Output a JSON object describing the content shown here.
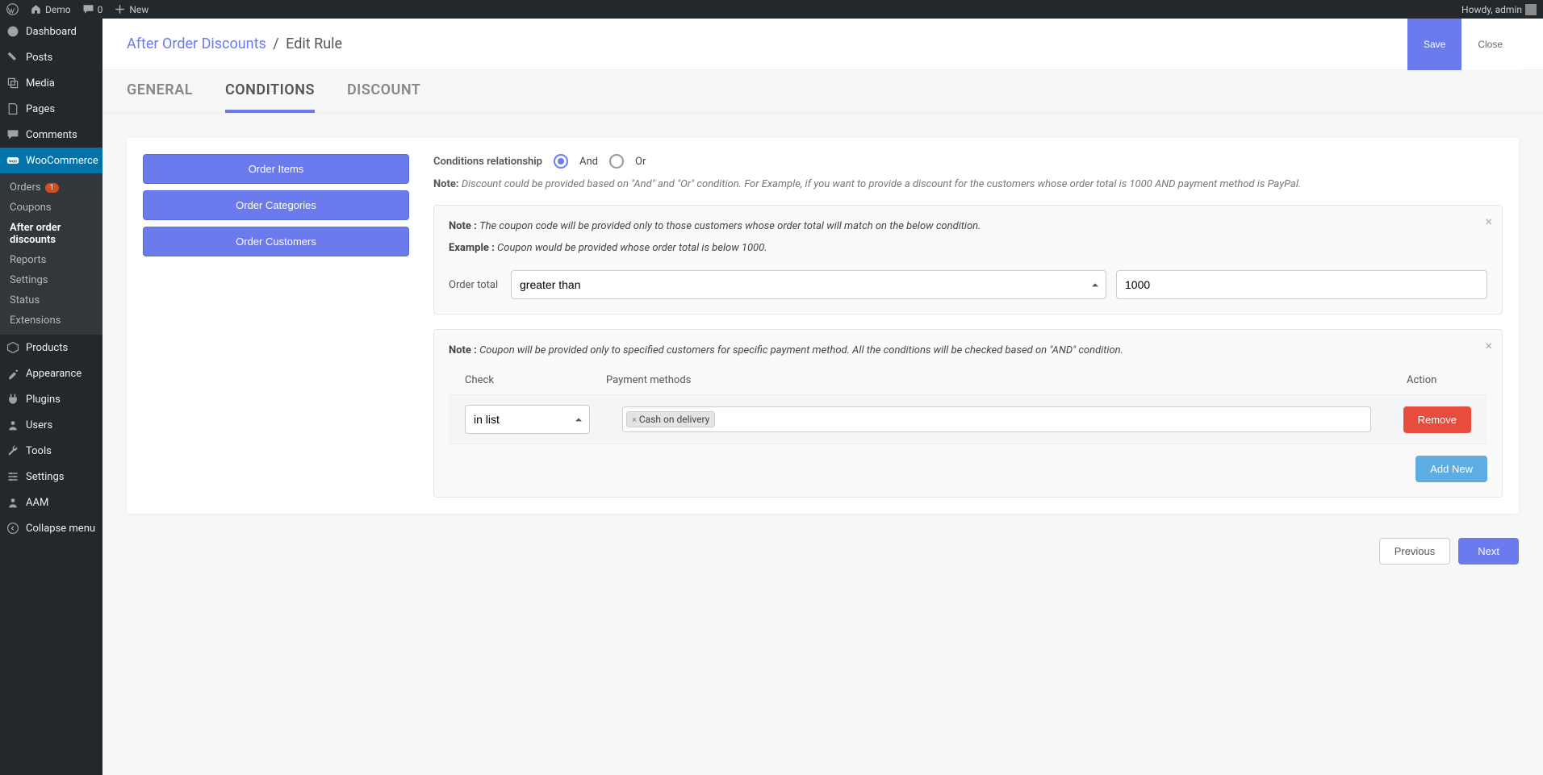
{
  "admin_bar": {
    "site_name": "Demo",
    "comments_count": "0",
    "new_label": "New",
    "howdy": "Howdy, admin"
  },
  "sidebar": {
    "items": [
      {
        "label": "Dashboard",
        "icon": "dashboard"
      },
      {
        "label": "Posts",
        "icon": "pin"
      },
      {
        "label": "Media",
        "icon": "media"
      },
      {
        "label": "Pages",
        "icon": "page"
      },
      {
        "label": "Comments",
        "icon": "comment"
      },
      {
        "label": "WooCommerce",
        "icon": "woo",
        "active": true
      },
      {
        "label": "Products",
        "icon": "box"
      },
      {
        "label": "Appearance",
        "icon": "brush"
      },
      {
        "label": "Plugins",
        "icon": "plug"
      },
      {
        "label": "Users",
        "icon": "user"
      },
      {
        "label": "Tools",
        "icon": "wrench"
      },
      {
        "label": "Settings",
        "icon": "sliders"
      },
      {
        "label": "AAM",
        "icon": "aam"
      }
    ],
    "woo_sub": [
      {
        "label": "Orders",
        "badge": "1"
      },
      {
        "label": "Coupons"
      },
      {
        "label": "After order discounts",
        "highlight": true
      },
      {
        "label": "Reports"
      },
      {
        "label": "Settings"
      },
      {
        "label": "Status"
      },
      {
        "label": "Extensions"
      }
    ],
    "collapse": "Collapse menu"
  },
  "header": {
    "crumb_parent": "After Order Discounts",
    "crumb_current": "Edit Rule",
    "save": "Save",
    "close": "Close"
  },
  "tabs": [
    "GENERAL",
    "CONDITIONS",
    "DISCOUNT"
  ],
  "side_buttons": [
    "Order Items",
    "Order Categories",
    "Order Customers"
  ],
  "relationship": {
    "label": "Conditions relationship",
    "and": "And",
    "or": "Or",
    "selected": "and"
  },
  "rel_note": {
    "prefix": "Note:",
    "body": "Discount could be provided based on \"And\" and \"Or\" condition. For Example, if you want to provide a discount for the customers whose order total is 1000 AND payment method is PayPal."
  },
  "box1": {
    "note_prefix": "Note :",
    "note_body": "The coupon code will be provided only to those customers whose order total will match on the below condition.",
    "example_prefix": "Example :",
    "example_body": "Coupon would be provided whose order total is below 1000.",
    "field_label": "Order total",
    "select_value": "greater than",
    "input_value": "1000"
  },
  "box2": {
    "note_prefix": "Note :",
    "note_body": "Coupon will be provided only to specified customers for specific payment method. All the conditions will be checked based on \"AND\" condition.",
    "th_check": "Check",
    "th_payment": "Payment methods",
    "th_action": "Action",
    "check_value": "in list",
    "tag": "Cash on delivery",
    "remove": "Remove",
    "add_new": "Add New"
  },
  "footer": {
    "previous": "Previous",
    "next": "Next"
  }
}
